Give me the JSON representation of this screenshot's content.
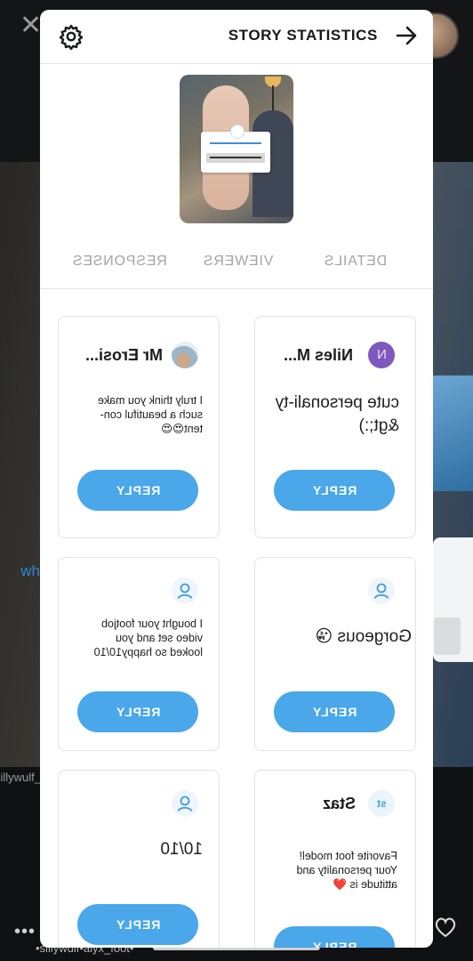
{
  "background": {
    "username": "sillywulf_alyx_foot",
    "bottom_username": "•sillywulf•alyx_foot•",
    "dots": "•••",
    "side_card_text": "wh"
  },
  "header": {
    "title": "STORY STATISTICS",
    "settings_icon": "gear-icon",
    "forward_icon": "arrow-right-icon"
  },
  "tabs": [
    {
      "label": "RESPONSES"
    },
    {
      "label": "VIEWERS"
    },
    {
      "label": "DETAILS"
    }
  ],
  "responses": [
    {
      "name": "Mr Erosi...",
      "avatar": "photo",
      "message": "I truly think you make such a beautiful con-tent😍😍",
      "reply_label": "REPLY"
    },
    {
      "name": "Niles M...",
      "avatar": "N",
      "message": "cute personali-ty &gt;:)",
      "reply_label": "REPLY"
    },
    {
      "name": "",
      "avatar": "user-icon",
      "message": "I bought your footjob video set and you looked so happy10/10",
      "reply_label": "REPLY"
    },
    {
      "name": "",
      "avatar": "user-icon",
      "message": "Gorgeous 😘",
      "reply_label": "REPLY"
    },
    {
      "name": "",
      "avatar": "user-icon",
      "message": "10/10",
      "reply_label": "REPLY"
    },
    {
      "name": "Staz",
      "avatar": "st",
      "message": "Favorite foot model! Your personality and attitude is ❤️",
      "reply_label": "REPLY"
    }
  ],
  "colors": {
    "accent": "#49a7ea",
    "avatar_purple": "#7e58bf",
    "tab_inactive": "#a0a4a9"
  }
}
